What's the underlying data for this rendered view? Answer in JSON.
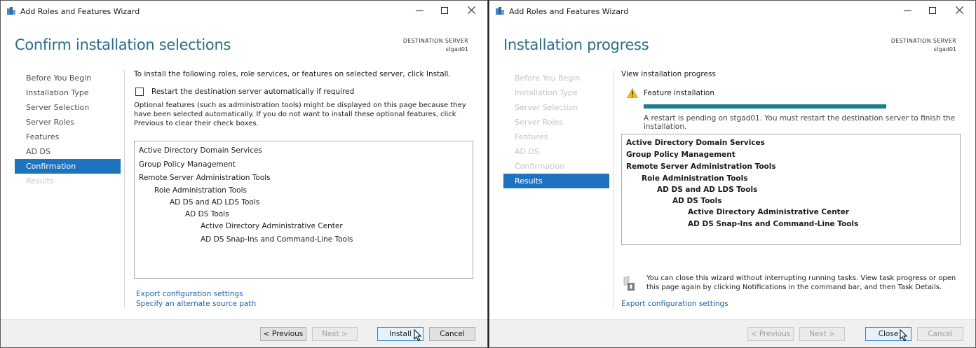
{
  "left": {
    "title": "Add Roles and Features Wizard",
    "heading": "Confirm installation selections",
    "destination_label": "DESTINATION SERVER",
    "destination_server": "stgad01",
    "nav": [
      {
        "label": "Before You Begin",
        "state": "normal"
      },
      {
        "label": "Installation Type",
        "state": "normal"
      },
      {
        "label": "Server Selection",
        "state": "normal"
      },
      {
        "label": "Server Roles",
        "state": "normal"
      },
      {
        "label": "Features",
        "state": "normal"
      },
      {
        "label": "AD DS",
        "state": "normal"
      },
      {
        "label": "Confirmation",
        "state": "selected"
      },
      {
        "label": "Results",
        "state": "disabled"
      }
    ],
    "intro": "To install the following roles, role services, or features on selected server, click Install.",
    "restart_checkbox": {
      "label": "Restart the destination server automatically if required",
      "checked": false
    },
    "optional_note": "Optional features (such as administration tools) might be displayed on this page because they have been selected automatically. If you do not want to install these optional features, click Previous to clear their check boxes.",
    "features": [
      {
        "label": "Active Directory Domain Services",
        "level": 0
      },
      {
        "label": "Group Policy Management",
        "level": 0
      },
      {
        "label": "Remote Server Administration Tools",
        "level": 0
      },
      {
        "label": "Role Administration Tools",
        "level": 1
      },
      {
        "label": "AD DS and AD LDS Tools",
        "level": 2
      },
      {
        "label": "AD DS Tools",
        "level": 3
      },
      {
        "label": "Active Directory Administrative Center",
        "level": 4
      },
      {
        "label": "AD DS Snap-Ins and Command-Line Tools",
        "level": 4
      }
    ],
    "links": {
      "export": "Export configuration settings",
      "alternate": "Specify an alternate source path"
    },
    "buttons": {
      "previous": "< Previous",
      "next": "Next >",
      "install": "Install",
      "cancel": "Cancel"
    }
  },
  "right": {
    "title": "Add Roles and Features Wizard",
    "heading": "Installation progress",
    "destination_label": "DESTINATION SERVER",
    "destination_server": "stgad01",
    "nav": [
      {
        "label": "Before You Begin",
        "state": "disabled"
      },
      {
        "label": "Installation Type",
        "state": "disabled"
      },
      {
        "label": "Server Selection",
        "state": "disabled"
      },
      {
        "label": "Server Roles",
        "state": "disabled"
      },
      {
        "label": "Features",
        "state": "disabled"
      },
      {
        "label": "AD DS",
        "state": "disabled"
      },
      {
        "label": "Confirmation",
        "state": "disabled"
      },
      {
        "label": "Results",
        "state": "selected"
      }
    ],
    "view_progress": "View installation progress",
    "feature_installation": "Feature installation",
    "progress": 1.0,
    "restart_note": "A restart is pending on stgad01. You must restart the destination server to finish the installation.",
    "features": [
      {
        "label": "Active Directory Domain Services",
        "level": 0
      },
      {
        "label": "Group Policy Management",
        "level": 0
      },
      {
        "label": "Remote Server Administration Tools",
        "level": 0
      },
      {
        "label": "Role Administration Tools",
        "level": 1
      },
      {
        "label": "AD DS and AD LDS Tools",
        "level": 2
      },
      {
        "label": "AD DS Tools",
        "level": 3
      },
      {
        "label": "Active Directory Administrative Center",
        "level": 4
      },
      {
        "label": "AD DS Snap-Ins and Command-Line Tools",
        "level": 4
      }
    ],
    "notice": "You can close this wizard without interrupting running tasks. View task progress or open this page again by clicking Notifications in the command bar, and then Task Details.",
    "links": {
      "export": "Export configuration settings"
    },
    "buttons": {
      "previous": "< Previous",
      "next": "Next >",
      "close": "Close",
      "cancel": "Cancel"
    }
  },
  "colors": {
    "heading": "#2a6e86",
    "nav_selected": "#1e73be",
    "progress": "#1e7d8a",
    "link": "#1e63a8"
  },
  "icons": {
    "app": "server-manager-icon",
    "warning": "warning-icon",
    "notice": "notification-flag-icon"
  }
}
